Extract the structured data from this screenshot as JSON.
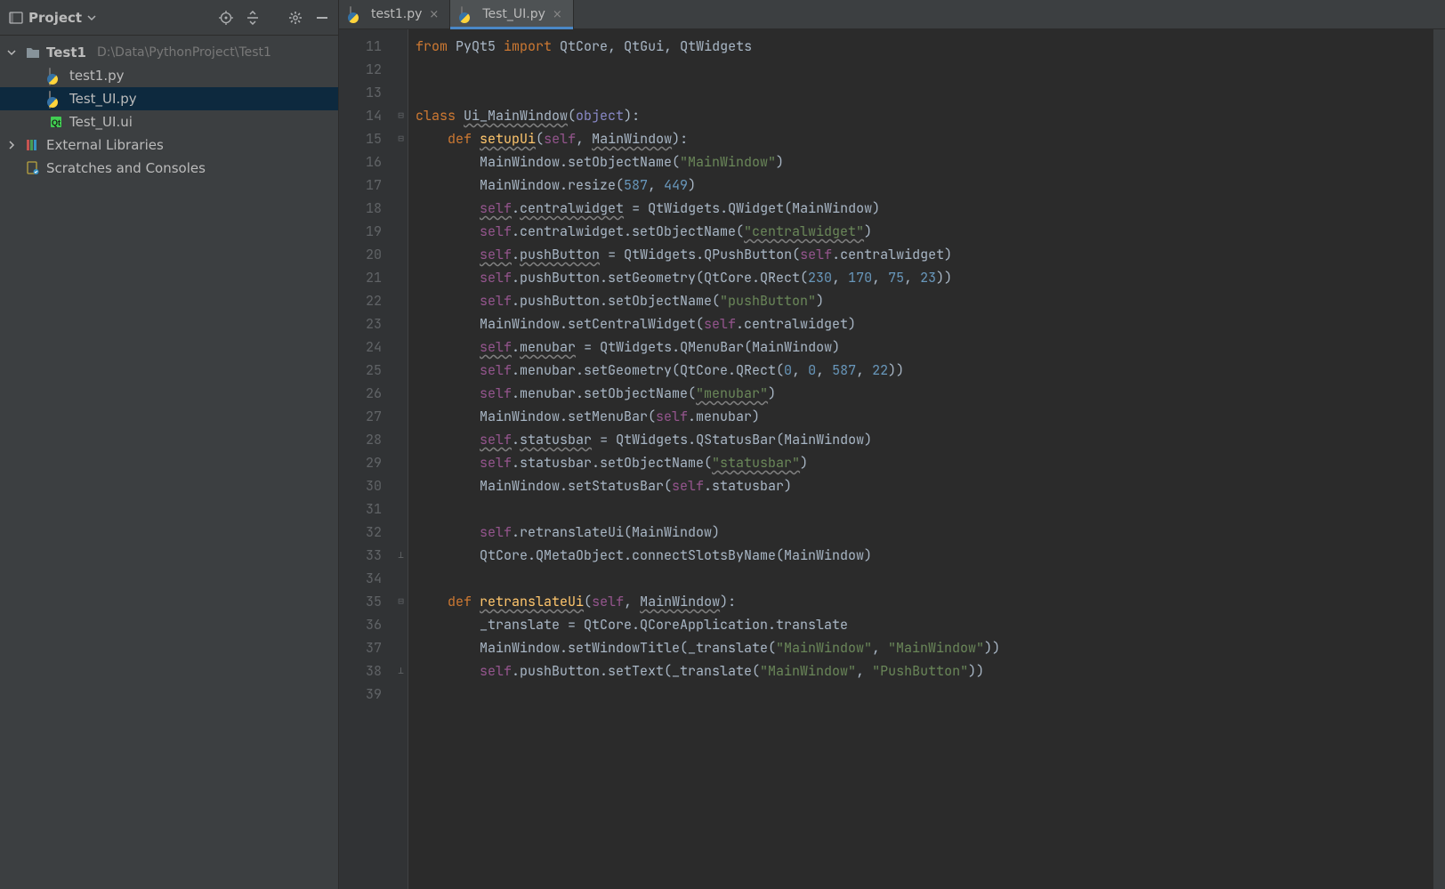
{
  "sidebar": {
    "title": "Project",
    "tree": {
      "root": {
        "label": "Test1",
        "path": "D:\\Data\\PythonProject\\Test1"
      },
      "files": [
        {
          "label": "test1.py",
          "type": "py",
          "selected": false
        },
        {
          "label": "Test_UI.py",
          "type": "py",
          "selected": true
        },
        {
          "label": "Test_UI.ui",
          "type": "ui",
          "selected": false
        }
      ],
      "external": "External Libraries",
      "scratches": "Scratches and Consoles"
    }
  },
  "tabs": [
    {
      "label": "test1.py",
      "active": false
    },
    {
      "label": "Test_UI.py",
      "active": true
    }
  ],
  "editor": {
    "first_line_no": 11,
    "last_line_no": 39,
    "folds": {
      "14": "⊟",
      "15": "⊟",
      "33": "⊥",
      "35": "⊟",
      "38": "⊥"
    },
    "lines": [
      {
        "n": 11,
        "tokens": [
          [
            "kw",
            "from"
          ],
          [
            "pn",
            " PyQt5 "
          ],
          [
            "kw",
            "import"
          ],
          [
            "pn",
            " QtCore"
          ],
          [
            "pn",
            ","
          ],
          [
            "pn",
            " QtGui"
          ],
          [
            "pn",
            ","
          ],
          [
            "pn",
            " QtWidgets"
          ]
        ]
      },
      {
        "n": 12,
        "tokens": []
      },
      {
        "n": 13,
        "tokens": []
      },
      {
        "n": 14,
        "tokens": [
          [
            "kw",
            "class "
          ],
          [
            "cls",
            "Ui_MainWindow"
          ],
          [
            "pn",
            "("
          ],
          [
            "bi",
            "object"
          ],
          [
            "pn",
            "):"
          ]
        ]
      },
      {
        "n": 15,
        "tokens": [
          [
            "pn",
            "    "
          ],
          [
            "kw",
            "def "
          ],
          [
            "fnu",
            "setupUi"
          ],
          [
            "pn",
            "("
          ],
          [
            "slf",
            "self"
          ],
          [
            "pn",
            ", "
          ],
          [
            "prmu",
            "MainWindow"
          ],
          [
            "pn",
            "):"
          ]
        ]
      },
      {
        "n": 16,
        "tokens": [
          [
            "pn",
            "        MainWindow.setObjectName("
          ],
          [
            "str",
            "\"MainWindow\""
          ],
          [
            "pn",
            ")"
          ]
        ]
      },
      {
        "n": 17,
        "tokens": [
          [
            "pn",
            "        MainWindow.resize("
          ],
          [
            "num",
            "587"
          ],
          [
            "pn",
            ", "
          ],
          [
            "num",
            "449"
          ],
          [
            "pn",
            ")"
          ]
        ]
      },
      {
        "n": 18,
        "tokens": [
          [
            "pn",
            "        "
          ],
          [
            "slfu",
            "self"
          ],
          [
            "pn",
            "."
          ],
          [
            "prmu",
            "centralwidget"
          ],
          [
            "pn",
            " = QtWidgets.QWidget(MainWindow)"
          ]
        ]
      },
      {
        "n": 19,
        "tokens": [
          [
            "pn",
            "        "
          ],
          [
            "slf",
            "self"
          ],
          [
            "pn",
            ".centralwidget.setObjectName("
          ],
          [
            "stru",
            "\"centralwidget\""
          ],
          [
            "pn",
            ")"
          ]
        ]
      },
      {
        "n": 20,
        "tokens": [
          [
            "pn",
            "        "
          ],
          [
            "slfu",
            "self"
          ],
          [
            "pn",
            "."
          ],
          [
            "prmu",
            "pushButton"
          ],
          [
            "pn",
            " = QtWidgets.QPushButton("
          ],
          [
            "slf",
            "self"
          ],
          [
            "pn",
            ".centralwidget)"
          ]
        ]
      },
      {
        "n": 21,
        "tokens": [
          [
            "pn",
            "        "
          ],
          [
            "slf",
            "self"
          ],
          [
            "pn",
            ".pushButton.setGeometry(QtCore.QRect("
          ],
          [
            "num",
            "230"
          ],
          [
            "pn",
            ", "
          ],
          [
            "num",
            "170"
          ],
          [
            "pn",
            ", "
          ],
          [
            "num",
            "75"
          ],
          [
            "pn",
            ", "
          ],
          [
            "num",
            "23"
          ],
          [
            "pn",
            "))"
          ]
        ]
      },
      {
        "n": 22,
        "tokens": [
          [
            "pn",
            "        "
          ],
          [
            "slf",
            "self"
          ],
          [
            "pn",
            ".pushButton.setObjectName("
          ],
          [
            "str",
            "\"pushButton\""
          ],
          [
            "pn",
            ")"
          ]
        ]
      },
      {
        "n": 23,
        "tokens": [
          [
            "pn",
            "        MainWindow.setCentralWidget("
          ],
          [
            "slf",
            "self"
          ],
          [
            "pn",
            ".centralwidget)"
          ]
        ]
      },
      {
        "n": 24,
        "tokens": [
          [
            "pn",
            "        "
          ],
          [
            "slfu",
            "self"
          ],
          [
            "pn",
            "."
          ],
          [
            "prmu",
            "menubar"
          ],
          [
            "pn",
            " = QtWidgets.QMenuBar(MainWindow)"
          ]
        ]
      },
      {
        "n": 25,
        "tokens": [
          [
            "pn",
            "        "
          ],
          [
            "slf",
            "self"
          ],
          [
            "pn",
            ".menubar.setGeometry(QtCore.QRect("
          ],
          [
            "num",
            "0"
          ],
          [
            "pn",
            ", "
          ],
          [
            "num",
            "0"
          ],
          [
            "pn",
            ", "
          ],
          [
            "num",
            "587"
          ],
          [
            "pn",
            ", "
          ],
          [
            "num",
            "22"
          ],
          [
            "pn",
            "))"
          ]
        ]
      },
      {
        "n": 26,
        "tokens": [
          [
            "pn",
            "        "
          ],
          [
            "slf",
            "self"
          ],
          [
            "pn",
            ".menubar.setObjectName("
          ],
          [
            "stru",
            "\"menubar\""
          ],
          [
            "pn",
            ")"
          ]
        ]
      },
      {
        "n": 27,
        "tokens": [
          [
            "pn",
            "        MainWindow.setMenuBar("
          ],
          [
            "slf",
            "self"
          ],
          [
            "pn",
            ".menubar)"
          ]
        ]
      },
      {
        "n": 28,
        "tokens": [
          [
            "pn",
            "        "
          ],
          [
            "slfu",
            "self"
          ],
          [
            "pn",
            "."
          ],
          [
            "prmu",
            "statusbar"
          ],
          [
            "pn",
            " = QtWidgets.QStatusBar(MainWindow)"
          ]
        ]
      },
      {
        "n": 29,
        "tokens": [
          [
            "pn",
            "        "
          ],
          [
            "slf",
            "self"
          ],
          [
            "pn",
            ".statusbar.setObjectName("
          ],
          [
            "stru",
            "\"statusbar\""
          ],
          [
            "pn",
            ")"
          ]
        ]
      },
      {
        "n": 30,
        "tokens": [
          [
            "pn",
            "        MainWindow.setStatusBar("
          ],
          [
            "slf",
            "self"
          ],
          [
            "pn",
            ".statusbar)"
          ]
        ]
      },
      {
        "n": 31,
        "tokens": []
      },
      {
        "n": 32,
        "tokens": [
          [
            "pn",
            "        "
          ],
          [
            "slf",
            "self"
          ],
          [
            "pn",
            ".retranslateUi(MainWindow)"
          ]
        ]
      },
      {
        "n": 33,
        "tokens": [
          [
            "pn",
            "        QtCore.QMetaObject.connectSlotsByName(MainWindow)"
          ]
        ]
      },
      {
        "n": 34,
        "tokens": []
      },
      {
        "n": 35,
        "tokens": [
          [
            "pn",
            "    "
          ],
          [
            "kw",
            "def "
          ],
          [
            "fnu",
            "retranslateUi"
          ],
          [
            "pn",
            "("
          ],
          [
            "slf",
            "self"
          ],
          [
            "pn",
            ", "
          ],
          [
            "prmu",
            "MainWindow"
          ],
          [
            "pn",
            "):"
          ]
        ]
      },
      {
        "n": 36,
        "tokens": [
          [
            "pn",
            "        _translate = QtCore.QCoreApplication.translate"
          ]
        ]
      },
      {
        "n": 37,
        "tokens": [
          [
            "pn",
            "        MainWindow.setWindowTitle(_translate("
          ],
          [
            "str",
            "\"MainWindow\""
          ],
          [
            "pn",
            ", "
          ],
          [
            "str",
            "\"MainWindow\""
          ],
          [
            "pn",
            "))"
          ]
        ]
      },
      {
        "n": 38,
        "tokens": [
          [
            "pn",
            "        "
          ],
          [
            "slf",
            "self"
          ],
          [
            "pn",
            ".pushButton.setText(_translate("
          ],
          [
            "str",
            "\"MainWindow\""
          ],
          [
            "pn",
            ", "
          ],
          [
            "str",
            "\"PushButton\""
          ],
          [
            "pn",
            "))"
          ]
        ]
      },
      {
        "n": 39,
        "tokens": []
      }
    ]
  }
}
